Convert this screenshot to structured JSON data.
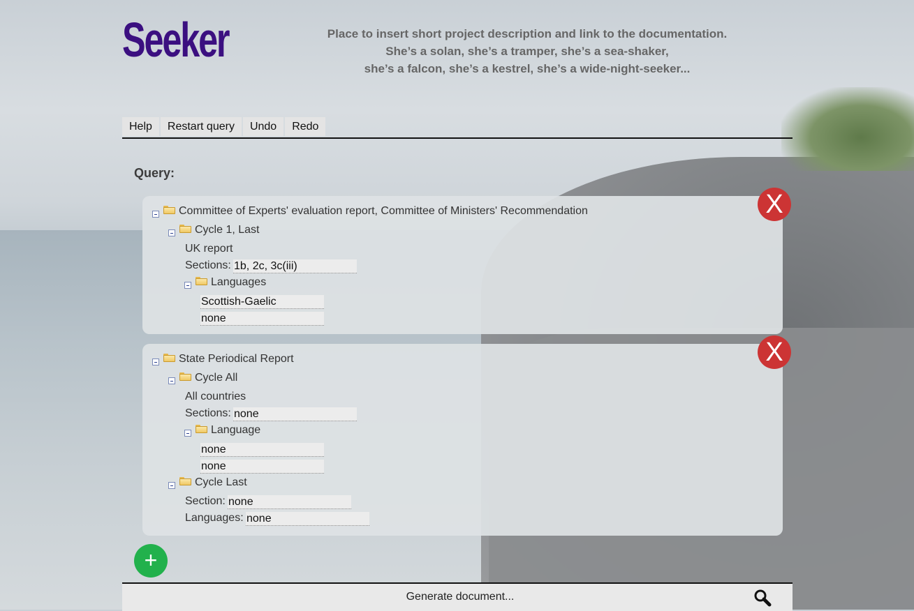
{
  "header": {
    "logo": "Seeker",
    "description_lines": [
      "Place to insert short project description and link to the documentation.",
      "She’s a solan, she’s a tramper, she’s a sea-shaker,",
      "she’s a falcon, she’s a kestrel, she’s a wide-night-seeker..."
    ]
  },
  "menu": {
    "help": "Help",
    "restart": "Restart query",
    "undo": "Undo",
    "redo": "Redo"
  },
  "query_label": "Query:",
  "cards": [
    {
      "title": "Committee of Experts' evaluation report, Committee of Ministers' Recommendation",
      "cycle": "Cycle 1, Last",
      "country": "UK report",
      "sections_label": "Sections:",
      "sections_value": "1b, 2c, 3c(iii)",
      "languages_label": "Languages",
      "languages": [
        "Scottish-Gaelic",
        "none"
      ],
      "close_label": "X"
    },
    {
      "title": "State Periodical Report",
      "cycle": "Cycle All",
      "country": "All countries",
      "sections_label": "Sections:",
      "sections_value": "none",
      "language_label": "Language",
      "languages": [
        "none",
        "none"
      ],
      "cycle2": "Cycle Last",
      "section_label": "Section:",
      "section_value": "none",
      "languages2_label": "Languages:",
      "languages2_value": "none",
      "close_label": "X"
    }
  ],
  "add_label": "+",
  "footer": {
    "generate": "Generate document...",
    "icon": "search-icon"
  },
  "colors": {
    "logo": "#3b0f80",
    "close": "#cc3434",
    "add": "#22b14c"
  }
}
